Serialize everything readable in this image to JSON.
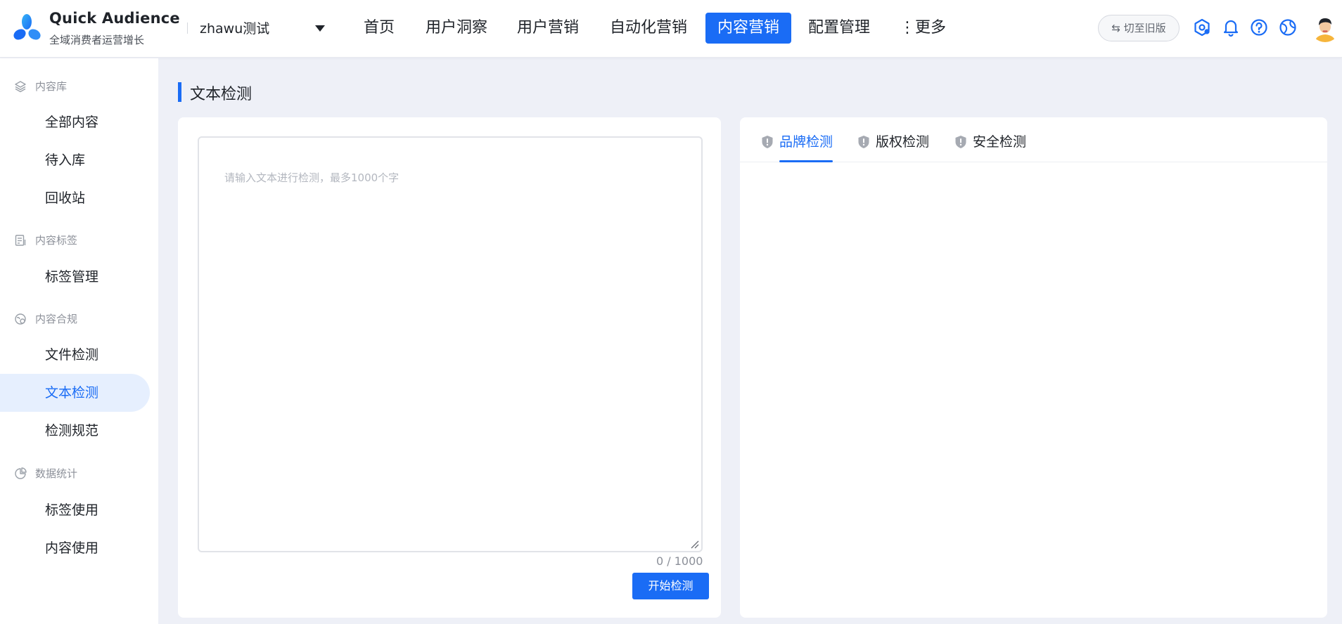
{
  "header": {
    "brand_name": "Quick Audience",
    "brand_sub": "全域消费者运营增长",
    "workspace": "zhawu测试",
    "nav": [
      "首页",
      "用户洞察",
      "用户营销",
      "自动化营销",
      "内容营销",
      "配置管理",
      "⋮更多"
    ],
    "active_nav": "内容营销",
    "switch_label": "⇆ 切至旧版",
    "icons": [
      "settings-hex-icon",
      "bell-icon",
      "help-icon",
      "globe-icon",
      "user-avatar"
    ]
  },
  "sidebar": {
    "groups": [
      {
        "label": "内容库",
        "icon": "layers-icon",
        "items": [
          "全部内容",
          "待入库",
          "回收站"
        ]
      },
      {
        "label": "内容标签",
        "icon": "tag-doc-icon",
        "items": [
          "标签管理"
        ]
      },
      {
        "label": "内容合规",
        "icon": "compliance-icon",
        "items": [
          "文件检测",
          "文本检测",
          "检测规范"
        ]
      },
      {
        "label": "数据统计",
        "icon": "pie-chart-icon",
        "items": [
          "标签使用",
          "内容使用"
        ]
      }
    ],
    "active_item": "文本检测"
  },
  "main": {
    "title": "文本检测",
    "input": {
      "placeholder": "请输入文本进行检测，最多1000个字",
      "counter": "0 / 1000"
    },
    "start_button": "开始检测",
    "tabs": [
      "品牌检测",
      "版权检测",
      "安全检测"
    ],
    "active_tab": "品牌检测"
  },
  "colors": {
    "accent": "#1a6cf5",
    "page_bg": "#eef0f7"
  }
}
